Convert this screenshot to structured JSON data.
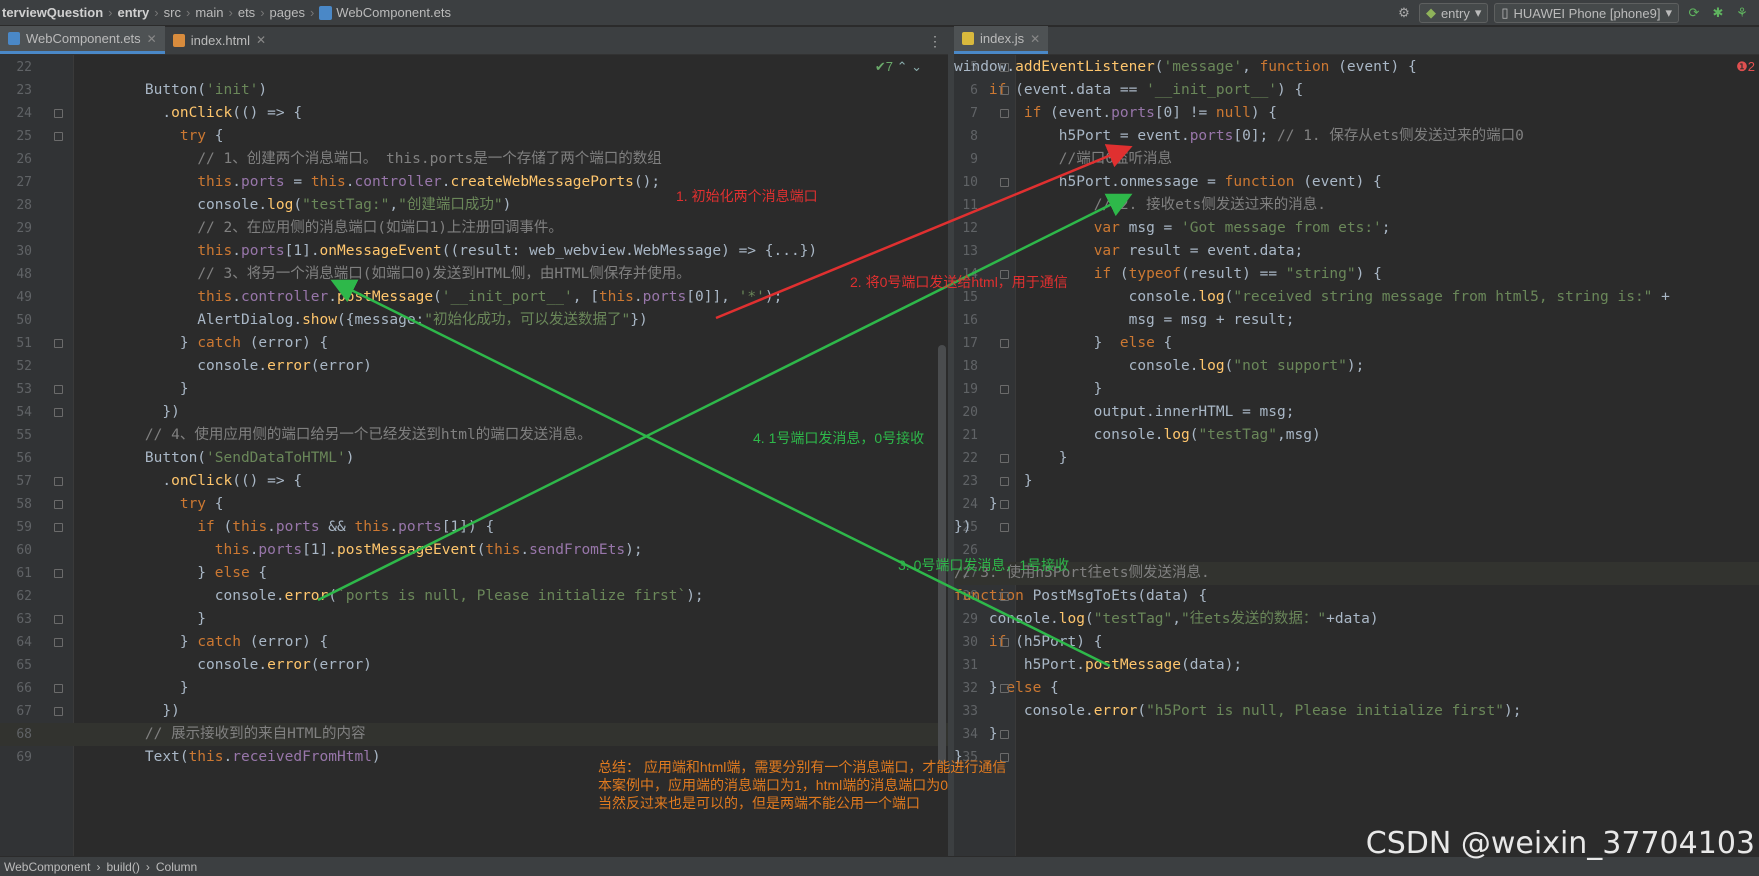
{
  "breadcrumb": {
    "items": [
      "terviewQuestion",
      "entry",
      "src",
      "main",
      "ets",
      "pages",
      "WebComponent.ets"
    ]
  },
  "toolbar": {
    "module": "entry",
    "device": "HUAWEI Phone [phone9]"
  },
  "left_tabs": [
    {
      "label": "WebComponent.ets",
      "active": true
    },
    {
      "label": "index.html",
      "active": false
    }
  ],
  "right_tabs": [
    {
      "label": "index.js",
      "active": true
    }
  ],
  "left_inspect": "✔7",
  "right_inspect": "❶2",
  "left_code": [
    {
      "n": "22",
      "t": ""
    },
    {
      "n": "23",
      "t": "    Button('init')"
    },
    {
      "n": "24",
      "t": "      .onClick(() => {"
    },
    {
      "n": "25",
      "t": "        try {"
    },
    {
      "n": "26",
      "t": "          // 1、创建两个消息端口。 this.ports是一个存储了两个端口的数组"
    },
    {
      "n": "27",
      "t": "          this.ports = this.controller.createWebMessagePorts();"
    },
    {
      "n": "28",
      "t": "          console.log(\"testTag:\",\"创建端口成功\")"
    },
    {
      "n": "29",
      "t": "          // 2、在应用侧的消息端口(如端口1)上注册回调事件。"
    },
    {
      "n": "30",
      "t": "          this.ports[1].onMessageEvent((result: web_webview.WebMessage) => {...})"
    },
    {
      "n": "48",
      "t": "          // 3、将另一个消息端口(如端口0)发送到HTML侧，由HTML侧保存并使用。"
    },
    {
      "n": "49",
      "t": "          this.controller.postMessage('__init_port__', [this.ports[0]], '*');"
    },
    {
      "n": "50",
      "t": "          AlertDialog.show({message:\"初始化成功，可以发送数据了\"})"
    },
    {
      "n": "51",
      "t": "        } catch (error) {"
    },
    {
      "n": "52",
      "t": "          console.error(error)"
    },
    {
      "n": "53",
      "t": "        }"
    },
    {
      "n": "54",
      "t": "      })"
    },
    {
      "n": "55",
      "t": "    // 4、使用应用侧的端口给另一个已经发送到html的端口发送消息。"
    },
    {
      "n": "56",
      "t": "    Button('SendDataToHTML')"
    },
    {
      "n": "57",
      "t": "      .onClick(() => {"
    },
    {
      "n": "58",
      "t": "        try {"
    },
    {
      "n": "59",
      "t": "          if (this.ports && this.ports[1]) {"
    },
    {
      "n": "60",
      "t": "            this.ports[1].postMessageEvent(this.sendFromEts);"
    },
    {
      "n": "61",
      "t": "          } else {"
    },
    {
      "n": "62",
      "t": "            console.error(`ports is null, Please initialize first`);"
    },
    {
      "n": "63",
      "t": "          }"
    },
    {
      "n": "64",
      "t": "        } catch (error) {"
    },
    {
      "n": "65",
      "t": "          console.error(error)"
    },
    {
      "n": "66",
      "t": "        }"
    },
    {
      "n": "67",
      "t": "      })"
    },
    {
      "n": "68",
      "t": "    // 展示接收到的来自HTML的内容"
    },
    {
      "n": "69",
      "t": "    Text(this.receivedFromHtml)"
    }
  ],
  "right_code": [
    {
      "n": "5",
      "t": "window.addEventListener('message', function (event) {"
    },
    {
      "n": "6",
      "t": "    if (event.data == '__init_port__') {"
    },
    {
      "n": "7",
      "t": "        if (event.ports[0] != null) {"
    },
    {
      "n": "8",
      "t": "            h5Port = event.ports[0]; // 1. 保存从ets侧发送过来的端口0"
    },
    {
      "n": "9",
      "t": "            //端口0监听消息"
    },
    {
      "n": "10",
      "t": "            h5Port.onmessage = function (event) {"
    },
    {
      "n": "11",
      "t": "                // 2. 接收ets侧发送过来的消息."
    },
    {
      "n": "12",
      "t": "                var msg = 'Got message from ets:';"
    },
    {
      "n": "13",
      "t": "                var result = event.data;"
    },
    {
      "n": "14",
      "t": "                if (typeof(result) == \"string\") {"
    },
    {
      "n": "15",
      "t": "                    console.log(\"received string message from html5, string is:\" +"
    },
    {
      "n": "16",
      "t": "                    msg = msg + result;"
    },
    {
      "n": "17",
      "t": "                }  else {"
    },
    {
      "n": "18",
      "t": "                    console.log(\"not support\");"
    },
    {
      "n": "19",
      "t": "                }"
    },
    {
      "n": "20",
      "t": "                output.innerHTML = msg;"
    },
    {
      "n": "21",
      "t": "                console.log(\"testTag\",msg)"
    },
    {
      "n": "22",
      "t": "            }"
    },
    {
      "n": "23",
      "t": "        }"
    },
    {
      "n": "24",
      "t": "    }"
    },
    {
      "n": "25",
      "t": "})"
    },
    {
      "n": "26",
      "t": ""
    },
    {
      "n": "27",
      "t": "// 3. 使用h5Port往ets侧发送消息."
    },
    {
      "n": "28",
      "t": "function PostMsgToEts(data) {"
    },
    {
      "n": "29",
      "t": "    console.log(\"testTag\",\"往ets发送的数据：\"+data)"
    },
    {
      "n": "30",
      "t": "    if (h5Port) {"
    },
    {
      "n": "31",
      "t": "        h5Port.postMessage(data);"
    },
    {
      "n": "32",
      "t": "    } else {"
    },
    {
      "n": "33",
      "t": "        console.error(\"h5Port is null, Please initialize first\");"
    },
    {
      "n": "34",
      "t": "    }"
    },
    {
      "n": "35",
      "t": "}"
    }
  ],
  "annotations": {
    "a1": "1. 初始化两个消息端口",
    "a2": "2. 将0号端口发送给html，用于通信",
    "a3": "3. 0号端口发消息，1号接收",
    "a4": "4. 1号端口发消息，0号接收",
    "summary1": "总结： 应用端和html端，需要分别有一个消息端口，才能进行通信",
    "summary2": "本案例中，应用端的消息端口为1，html端的消息端口为0",
    "summary3": "当然反过来也是可以的，但是两端不能公用一个端口"
  },
  "status_bar": [
    "WebComponent",
    "build()",
    "Column"
  ],
  "watermark": "CSDN @weixin_37704103",
  "colors": {
    "keyword": "#cc7832",
    "string": "#6a8759",
    "comment": "#808080",
    "function": "#ffc66d",
    "arrow_red": "#e03030",
    "arrow_green": "#2eb84a",
    "summary_orange": "#e07a1f"
  }
}
